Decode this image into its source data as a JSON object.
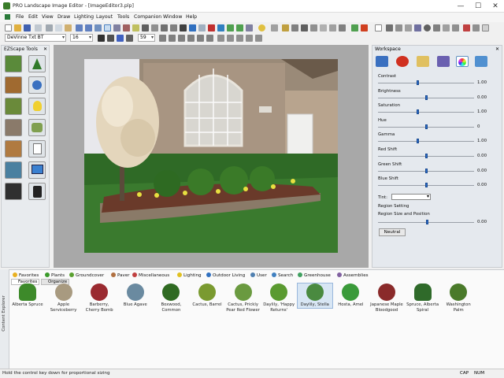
{
  "window": {
    "title": "PRO Landscape Image Editor - [ImageEditor3.plp]",
    "min": "—",
    "max": "☐",
    "close": "✕"
  },
  "menu": [
    "File",
    "Edit",
    "View",
    "Draw",
    "Lighting",
    "Layout",
    "Tools",
    "Companion",
    "Window",
    "Help"
  ],
  "toolbar": {
    "font": "DeVinne Txt BT",
    "size": "16",
    "extra": "59"
  },
  "ezscape": {
    "title": "EZScape Tools",
    "close": "✕"
  },
  "workspace": {
    "title": "Workspace",
    "close": "✕",
    "sliders": [
      {
        "label": "Contrast",
        "value": "1.00",
        "pos": 0.41
      },
      {
        "label": "Brightness",
        "value": "0.00",
        "pos": 0.5
      },
      {
        "label": "Saturation",
        "value": "1.00",
        "pos": 0.41
      },
      {
        "label": "Hue",
        "value": "0",
        "pos": 0.5
      },
      {
        "label": "Gamma",
        "value": "1.00",
        "pos": 0.41
      },
      {
        "label": "Red Shift",
        "value": "0.00",
        "pos": 0.5
      },
      {
        "label": "Green Shift",
        "value": "0.00",
        "pos": 0.5
      },
      {
        "label": "Blue Shift",
        "value": "0.00",
        "pos": 0.5
      }
    ],
    "tint_label": "Tint:",
    "region_setting": "Region Setting",
    "region_size": "Region Size and Position",
    "region_value": "0.00",
    "neutral": "Neutral"
  },
  "library": {
    "side_label": "Content Explorer",
    "tabs": [
      {
        "label": "Favorites",
        "color": "#e8b020"
      },
      {
        "label": "Plants",
        "color": "#3a9a2a"
      },
      {
        "label": "Groundcover",
        "color": "#5aa030"
      },
      {
        "label": "Paver",
        "color": "#b07040"
      },
      {
        "label": "Miscellaneous",
        "color": "#c04040"
      },
      {
        "label": "Lighting",
        "color": "#e0c020"
      },
      {
        "label": "Outdoor Living",
        "color": "#3070c0"
      },
      {
        "label": "User",
        "color": "#5080b0"
      },
      {
        "label": "Search",
        "color": "#4080c0"
      },
      {
        "label": "Greenhouse",
        "color": "#40a060"
      },
      {
        "label": "Assemblies",
        "color": "#8060a0"
      }
    ],
    "subtabs": [
      "Favorites",
      "Organize"
    ],
    "plants": [
      {
        "name": "Alberta Spruce",
        "color": "#3d8a2a"
      },
      {
        "name": "Apple Serviceberry",
        "color": "#a89a80"
      },
      {
        "name": "Barberry, Cherry Bomb",
        "color": "#9a2a30"
      },
      {
        "name": "Blue Agave",
        "color": "#6a8aa0"
      },
      {
        "name": "Boxwood, Common",
        "color": "#2f6a22"
      },
      {
        "name": "Cactus, Barrel",
        "color": "#7a9a30"
      },
      {
        "name": "Cactus, Prickly Pear Red Flower",
        "color": "#6a9a40"
      },
      {
        "name": "Daylily, 'Happy Returns'",
        "color": "#5a9a30"
      },
      {
        "name": "Daylily, Stella",
        "color": "#4a8a40"
      },
      {
        "name": "Hosta, Amel",
        "color": "#3a9a3a"
      },
      {
        "name": "Japanese Maple Bloodgood",
        "color": "#8a2a2a"
      },
      {
        "name": "Spruce, Alberta Spiral",
        "color": "#2f6a2a"
      },
      {
        "name": "Washington Palm",
        "color": "#4a7a2a"
      }
    ]
  },
  "status": {
    "hint": "Hold the control key down for proportional sizing",
    "cap": "CAP",
    "num": "NUM"
  }
}
